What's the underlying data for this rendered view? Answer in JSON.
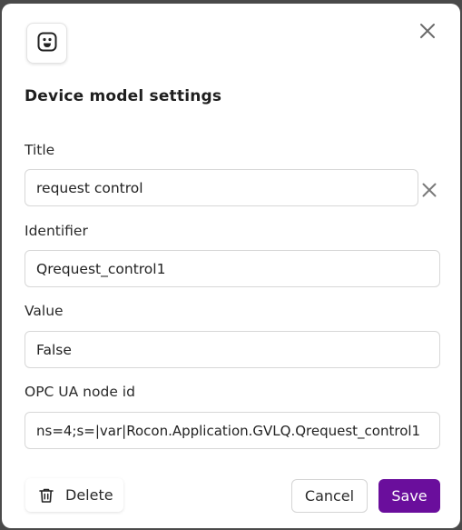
{
  "dialog": {
    "title": "Device model settings",
    "logo_icon": "smiley-face-icon",
    "close_icon": "close-icon"
  },
  "fields": {
    "title": {
      "label": "Title",
      "value": "request control"
    },
    "identifier": {
      "label": "Identifier",
      "value": "Qrequest_control1"
    },
    "value": {
      "label": "Value",
      "value": "False"
    },
    "opc_node_id": {
      "label": "OPC UA node id",
      "value": "ns=4;s=|var|Rocon.Application.GVLQ.Qrequest_control1"
    }
  },
  "actions": {
    "delete_label": "Delete",
    "cancel_label": "Cancel",
    "save_label": "Save"
  },
  "colors": {
    "primary": "#6a0e9c",
    "border": "#d7d7d7"
  }
}
